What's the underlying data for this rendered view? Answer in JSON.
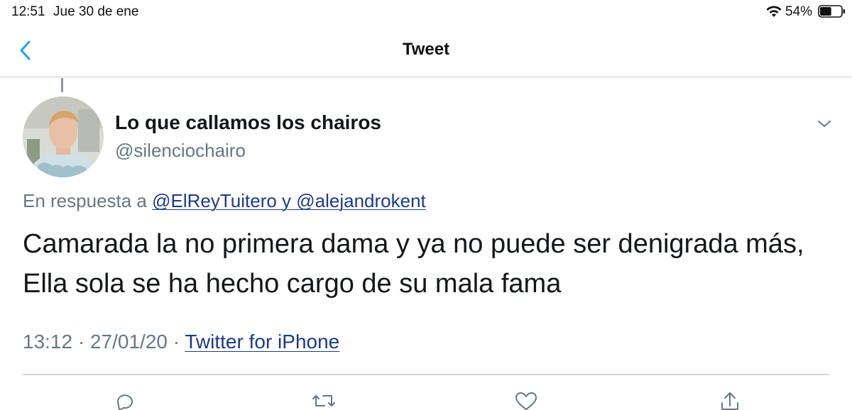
{
  "status_bar": {
    "time": "12:51",
    "date": "Jue 30 de ene",
    "battery_percent": "54%",
    "battery_level": 0.54,
    "icons": [
      "wifi-icon",
      "battery-icon"
    ]
  },
  "nav": {
    "title": "Tweet",
    "back_icon": "chevron-left-icon"
  },
  "tweet": {
    "author": {
      "display_name": "Lo que callamos los chairos",
      "handle": "@silenciochairo"
    },
    "reply_prefix": "En respuesta a",
    "reply_mentions": "@ElReyTuitero y @alejandrokent",
    "text_lines": [
      "Camarada la no primera dama y ya no puede ser denigrada más,",
      "Ella sola se ha hecho cargo de su mala fama"
    ],
    "meta": {
      "time": "13:12",
      "separator": "·",
      "date": "27/01/20",
      "source": "Twitter for iPhone"
    },
    "actions": [
      "reply-icon",
      "retweet-icon",
      "like-icon",
      "share-icon"
    ]
  },
  "colors": {
    "accent": "#1da1f2",
    "link": "#1b3a8a",
    "secondary_text": "#657786",
    "primary_text": "#14171a"
  }
}
